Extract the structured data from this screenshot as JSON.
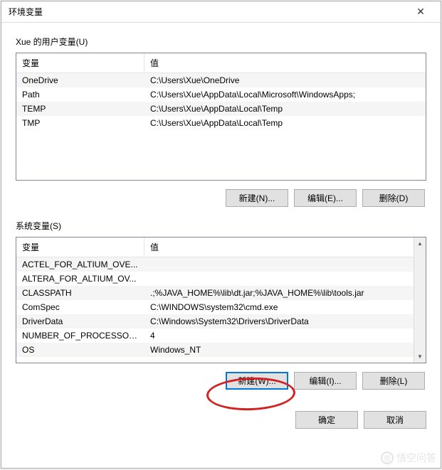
{
  "titlebar": {
    "title": "环境变量"
  },
  "user_section": {
    "label": "Xue 的用户变量(U)",
    "headers": {
      "name": "变量",
      "value": "值"
    },
    "rows": [
      {
        "name": "OneDrive",
        "value": "C:\\Users\\Xue\\OneDrive"
      },
      {
        "name": "Path",
        "value": "C:\\Users\\Xue\\AppData\\Local\\Microsoft\\WindowsApps;"
      },
      {
        "name": "TEMP",
        "value": "C:\\Users\\Xue\\AppData\\Local\\Temp"
      },
      {
        "name": "TMP",
        "value": "C:\\Users\\Xue\\AppData\\Local\\Temp"
      }
    ],
    "buttons": {
      "new": "新建(N)...",
      "edit": "编辑(E)...",
      "delete": "删除(D)"
    }
  },
  "sys_section": {
    "label": "系统变量(S)",
    "headers": {
      "name": "变量",
      "value": "值"
    },
    "rows": [
      {
        "name": "ACTEL_FOR_ALTIUM_OVE...",
        "value": ""
      },
      {
        "name": "ALTERA_FOR_ALTIUM_OV...",
        "value": ""
      },
      {
        "name": "CLASSPATH",
        "value": ".;%JAVA_HOME%\\lib\\dt.jar;%JAVA_HOME%\\lib\\tools.jar"
      },
      {
        "name": "ComSpec",
        "value": "C:\\WINDOWS\\system32\\cmd.exe"
      },
      {
        "name": "DriverData",
        "value": "C:\\Windows\\System32\\Drivers\\DriverData"
      },
      {
        "name": "NUMBER_OF_PROCESSORS",
        "value": "4"
      },
      {
        "name": "OS",
        "value": "Windows_NT"
      }
    ],
    "buttons": {
      "new": "新建(W)...",
      "edit": "编辑(I)...",
      "delete": "删除(L)"
    }
  },
  "footer": {
    "ok": "确定",
    "cancel": "取消"
  },
  "watermark": "悟空问答"
}
